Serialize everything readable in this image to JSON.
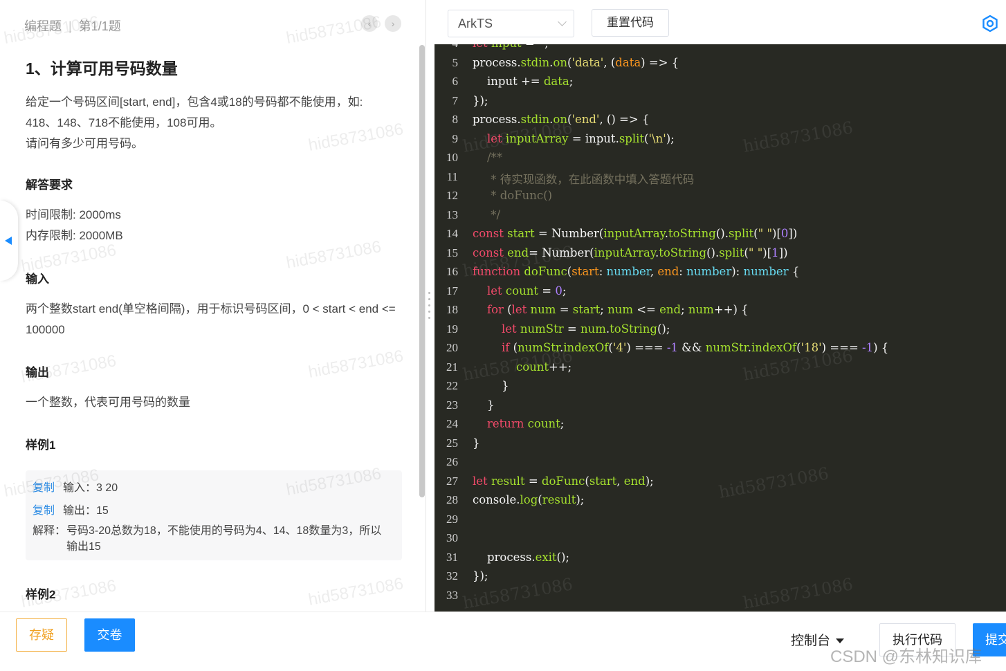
{
  "header": {
    "category": "编程题",
    "progress": "第1/1题"
  },
  "question": {
    "title": "1、计算可用号码数量",
    "description": [
      "给定一个号码区间[start, end]，包含4或18的号码都不能使用，如:",
      "418、148、718不能使用，108可用。",
      "请问有多少可用号码。"
    ],
    "requirements_heading": "解答要求",
    "time_limit": "时间限制: 2000ms",
    "memory_limit": "内存限制: 2000MB",
    "input_heading": "输入",
    "input_text": "两个整数start end(单空格间隔)，用于标识号码区间，0 < start < end <= 100000",
    "output_heading": "输出",
    "output_text": "一个整数，代表可用号码的数量",
    "example1_heading": "样例1",
    "example1": {
      "copy_label_1": "复制",
      "input": "输入：3 20",
      "copy_label_2": "复制",
      "output": "输出：15",
      "explain_label": "解释：",
      "explain": "号码3-20总数为18，不能使用的号码为4、14、18数量为3，所以输出15"
    },
    "example2_heading": "样例2"
  },
  "watermark": "hid58731086",
  "editor": {
    "language": "ArkTS",
    "reset_label": "重置代码"
  },
  "code_lines": [
    {
      "n": "4",
      "html": "<span class='kw'>let</span> <span class='id'>input</span> = <span class='str'>''</span>;"
    },
    {
      "n": "5",
      "html": "<span class='wt'>process</span>.<span class='id'>stdin</span>.<span class='fn'>on</span>(<span class='str'>'data'</span>, (<span class='param'>data</span>) => {"
    },
    {
      "n": "6",
      "html": "    <span class='wt'>input</span> += <span class='id'>data</span>;"
    },
    {
      "n": "7",
      "html": "});"
    },
    {
      "n": "8",
      "html": "<span class='wt'>process</span>.<span class='id'>stdin</span>.<span class='fn'>on</span>(<span class='str'>'end'</span>, () => {"
    },
    {
      "n": "9",
      "html": "    <span class='kw'>let</span> <span class='id'>inputArray</span> = <span class='wt'>input</span>.<span class='fn'>split</span>(<span class='str'>'\\n'</span>);"
    },
    {
      "n": "10",
      "html": "    <span class='cmt'>/**</span>"
    },
    {
      "n": "11",
      "html": "<span class='cmt'>     * 待实现函数，在此函数中填入答题代码</span>"
    },
    {
      "n": "12",
      "html": "<span class='cmt'>     * doFunc()</span>"
    },
    {
      "n": "13",
      "html": "<span class='cmt'>     */</span>"
    },
    {
      "n": "14",
      "html": "<span class='kw'>const</span> <span class='id'>start</span> = <span class='wt'>Number</span>(<span class='id'>inputArray</span>.<span class='fn'>toString</span>().<span class='fn'>split</span>(<span class='str'>\" \"</span>)[<span class='num'>0</span>])"
    },
    {
      "n": "15",
      "html": "<span class='kw'>const</span> <span class='id'>end</span>= <span class='wt'>Number</span>(<span class='id'>inputArray</span>.<span class='fn'>toString</span>().<span class='fn'>split</span>(<span class='str'>\" \"</span>)[<span class='num'>1</span>])"
    },
    {
      "n": "16",
      "html": "<span class='kw'>function</span> <span class='fn'>doFunc</span>(<span class='param'>start</span>: <span class='typ'>number</span>, <span class='param'>end</span>: <span class='typ'>number</span>): <span class='typ'>number</span> {"
    },
    {
      "n": "17",
      "html": "    <span class='kw'>let</span> <span class='id'>count</span> = <span class='num'>0</span>;"
    },
    {
      "n": "18",
      "html": "    <span class='kw'>for</span> (<span class='kw'>let</span> <span class='id'>num</span> = <span class='id'>start</span>; <span class='id'>num</span> <= <span class='id'>end</span>; <span class='id'>num</span>++) {"
    },
    {
      "n": "19",
      "html": "        <span class='kw'>let</span> <span class='id'>numStr</span> = <span class='id'>num</span>.<span class='fn'>toString</span>();"
    },
    {
      "n": "20",
      "html": "        <span class='kw'>if</span> (<span class='id'>numStr</span>.<span class='fn'>indexOf</span>(<span class='str'>'4'</span>) === <span class='num'>-1</span> && <span class='id'>numStr</span>.<span class='fn'>indexOf</span>(<span class='str'>'18'</span>) === <span class='num'>-1</span>) {"
    },
    {
      "n": "21",
      "html": "            <span class='id'>count</span>++;"
    },
    {
      "n": "22",
      "html": "        }"
    },
    {
      "n": "23",
      "html": "    }"
    },
    {
      "n": "24",
      "html": "    <span class='kw'>return</span> <span class='id'>count</span>;"
    },
    {
      "n": "25",
      "html": "}"
    },
    {
      "n": "26",
      "html": ""
    },
    {
      "n": "27",
      "html": "<span class='kw'>let</span> <span class='id'>result</span> = <span class='fn'>doFunc</span>(<span class='id'>start</span>, <span class='id'>end</span>);"
    },
    {
      "n": "28",
      "html": "<span class='wt'>console</span>.<span class='fn'>log</span>(<span class='id'>result</span>);"
    },
    {
      "n": "29",
      "html": ""
    },
    {
      "n": "30",
      "html": ""
    },
    {
      "n": "31",
      "html": "    <span class='wt'>process</span>.<span class='fn'>exit</span>();"
    },
    {
      "n": "32",
      "html": "});"
    },
    {
      "n": "33",
      "html": ""
    }
  ],
  "footer": {
    "doubt_label": "存疑",
    "submit_paper_label": "交卷",
    "console_label": "控制台",
    "run_label": "执行代码",
    "submit_label": "提交",
    "csdn_watermark": "CSDN @东林知识库"
  },
  "colors": {
    "accent": "#1a8cff",
    "doubt": "#f0a020",
    "editor_bg": "#282923"
  }
}
